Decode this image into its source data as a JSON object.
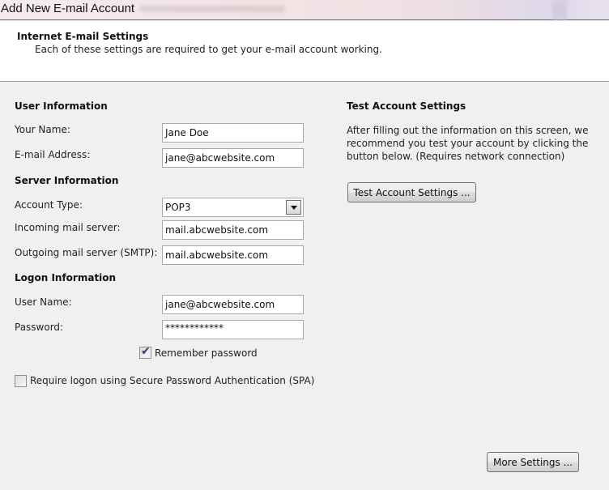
{
  "window": {
    "title": "Add New E-mail Account"
  },
  "header": {
    "title": "Internet E-mail Settings",
    "subtitle": "Each of these settings are required to get your e-mail account working."
  },
  "user_info": {
    "heading": "User Information",
    "name_label": "Your Name:",
    "name_value": "Jane Doe",
    "email_label": "E-mail Address:",
    "email_value": "jane@abcwebsite.com"
  },
  "server_info": {
    "heading": "Server Information",
    "account_type_label": "Account Type:",
    "account_type_value": "POP3",
    "incoming_label": "Incoming mail server:",
    "incoming_value": "mail.abcwebsite.com",
    "outgoing_label": "Outgoing mail server (SMTP):",
    "outgoing_value": "mail.abcwebsite.com"
  },
  "logon_info": {
    "heading": "Logon Information",
    "username_label": "User Name:",
    "username_value": "jane@abcwebsite.com",
    "password_label": "Password:",
    "password_value": "************",
    "remember_label": "Remember password",
    "remember_checked": true,
    "spa_label": "Require logon using Secure Password Authentication (SPA)",
    "spa_checked": false
  },
  "test_settings": {
    "heading": "Test Account Settings",
    "description_line1": "After filling out the information on this screen, we",
    "description_line2": "recommend you test your account by clicking the",
    "description_line3": "button below. (Requires network connection)",
    "button_label": "Test Account Settings ..."
  },
  "footer": {
    "more_settings_label": "More Settings ..."
  },
  "icons": {
    "check": "✔"
  }
}
